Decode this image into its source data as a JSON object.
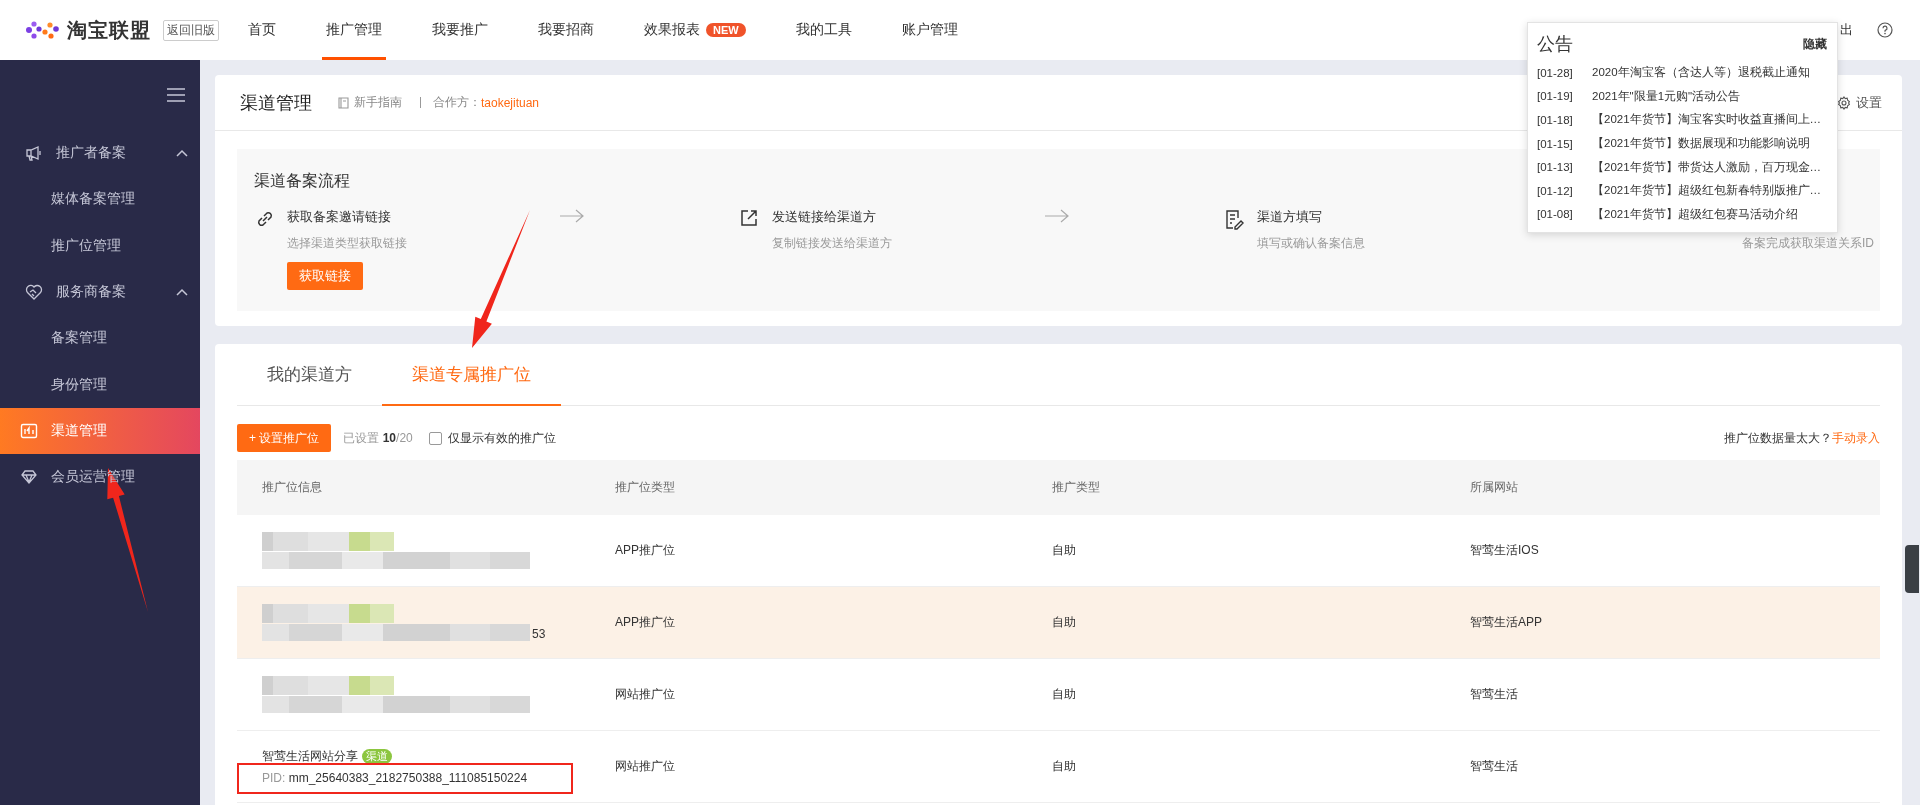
{
  "header": {
    "logo_text": "淘宝联盟",
    "old_version_tag": "返回旧版",
    "nav": [
      {
        "label": "首页",
        "selected": false
      },
      {
        "label": "推广管理",
        "selected": true
      },
      {
        "label": "我要推广",
        "selected": false
      },
      {
        "label": "我要招商",
        "selected": false
      },
      {
        "label": "效果报表",
        "selected": false,
        "badge": "NEW"
      },
      {
        "label": "我的工具",
        "selected": false
      },
      {
        "label": "账户管理",
        "selected": false
      }
    ],
    "logout_link": "出"
  },
  "sidebar": {
    "items": [
      {
        "label": "推广者备案",
        "kind": "group",
        "expanded": true,
        "children": [
          {
            "label": "媒体备案管理",
            "selected": false
          },
          {
            "label": "推广位管理",
            "selected": false
          }
        ]
      },
      {
        "label": "服务商备案",
        "kind": "group",
        "expanded": true,
        "children": [
          {
            "label": "备案管理",
            "selected": false
          },
          {
            "label": "身份管理",
            "selected": false
          }
        ]
      },
      {
        "label": "渠道管理",
        "kind": "link",
        "selected": true
      },
      {
        "label": "会员运营管理",
        "kind": "link",
        "selected": false
      }
    ]
  },
  "page_header": {
    "title": "渠道管理",
    "guide_link": "新手指南",
    "partner_label": "合作方：",
    "partner_name": "taokejituan",
    "settings_link": "设置"
  },
  "flow": {
    "title": "渠道备案流程",
    "steps": [
      {
        "title": "获取备案邀请链接",
        "description": "选择渠道类型获取链接",
        "button": "获取链接"
      },
      {
        "title": "发送链接给渠道方",
        "description": "复制链接发送给渠道方"
      },
      {
        "title": "渠道方填写",
        "description": "填写或确认备案信息"
      },
      {
        "description": "备案完成获取渠道关系ID"
      }
    ]
  },
  "tabs": [
    {
      "label": "我的渠道方",
      "selected": false
    },
    {
      "label": "渠道专属推广位",
      "selected": true
    }
  ],
  "toolbar": {
    "add_button": "+ 设置推广位",
    "quota": "已设置 **10**/20",
    "filter_checkbox": {
      "label": "仅显示有效的推广位",
      "checked": false
    },
    "hint": "推广位数据量太大？",
    "manual_link": "手动录入"
  },
  "table": {
    "columns": [
      "推广位信息",
      "推广位类型",
      "推广类型",
      "所属网站"
    ],
    "rows": [
      {
        "highlighted": false,
        "cells": [
          {
            "kind": "blurred"
          },
          "APP推广位",
          "自助",
          "智莺生活IOS"
        ]
      },
      {
        "highlighted": true,
        "cells": [
          {
            "kind": "blurred",
            "fragment": "53"
          },
          "APP推广位",
          "自助",
          "智莺生活APP"
        ]
      },
      {
        "highlighted": false,
        "cells": [
          {
            "kind": "blurred"
          },
          "网站推广位",
          "自助",
          "智莺生活"
        ]
      },
      {
        "highlighted": false,
        "cells": [
          {
            "kind": "named",
            "name": "智莺生活网站分享",
            "badge": "渠道",
            "pid_label": "PID:",
            "pid": "mm_25640383_2182750388_111085150224"
          },
          "网站推广位",
          "自助",
          "智莺生活"
        ]
      }
    ]
  },
  "notice": {
    "title": "公告",
    "hide_link": "隐藏",
    "items": [
      {
        "date": "[01-28]",
        "text": "2020年淘宝客（含达人等）退税截止通知"
      },
      {
        "date": "[01-19]",
        "text": "2021年\"限量1元购\"活动公告"
      },
      {
        "date": "[01-18]",
        "text": "【2021年货节】淘宝客实时收益直播间上…"
      },
      {
        "date": "[01-15]",
        "text": "【2021年货节】数据展现和功能影响说明"
      },
      {
        "date": "[01-13]",
        "text": "【2021年货节】带货达人激励，百万现金…"
      },
      {
        "date": "[01-12]",
        "text": "【2021年货节】超级红包新春特别版推广…"
      },
      {
        "date": "[01-08]",
        "text": "【2021年货节】超级红包赛马活动介绍"
      }
    ]
  }
}
